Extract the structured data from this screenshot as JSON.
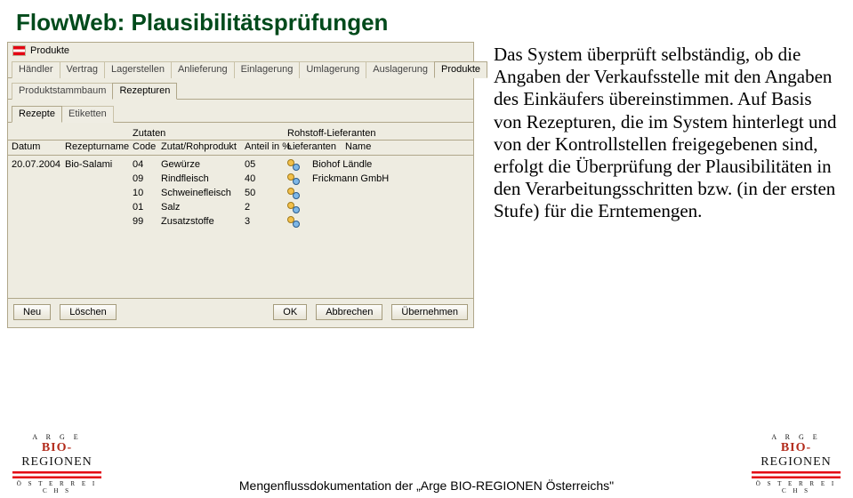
{
  "title": "FlowWeb: Plausibilitätsprüfungen",
  "description": "Das System überprüft selbständig, ob die Angaben der Verkaufsstelle mit den Angaben des Einkäufers übereinstimmen. Auf Basis von Rezepturen, die im System hinterlegt und von der Kontrollstellen freigegebenen sind, erfolgt die Überprüfung der Plausibilitäten in den Verarbeitungsschritten bzw. (in der ersten Stufe) für die Erntemengen.",
  "app": {
    "header_title": "Produkte",
    "main_tabs": [
      "Händler",
      "Vertrag",
      "Lagerstellen",
      "Anlieferung",
      "Einlagerung",
      "Umlagerung",
      "Auslagerung",
      "Produkte"
    ],
    "main_active": "Produkte",
    "sub_tabs": [
      "Produktstammbaum",
      "Rezepturen"
    ],
    "sub_active": "Rezepturen",
    "inner_tabs": [
      "Rezepte",
      "Etiketten"
    ],
    "inner_active": "Rezepte",
    "group_headers": {
      "zutaten": "Zutaten",
      "lieferanten": "Rohstoff-Lieferanten"
    },
    "col_headers": [
      "Datum",
      "Rezepturname",
      "Code",
      "Zutat/Rohprodukt",
      "Anteil in %",
      "Lieferanten",
      "Name"
    ],
    "rows": [
      {
        "date": "20.07.2004",
        "recipe": "Bio-Salami",
        "code": "04",
        "zutat": "Gewürze",
        "anteil": "05",
        "name": "Biohof Ländle"
      },
      {
        "date": "",
        "recipe": "",
        "code": "09",
        "zutat": "Rindfleisch",
        "anteil": "40",
        "name": "Frickmann GmbH"
      },
      {
        "date": "",
        "recipe": "",
        "code": "10",
        "zutat": "Schweinefleisch",
        "anteil": "50",
        "name": ""
      },
      {
        "date": "",
        "recipe": "",
        "code": "01",
        "zutat": "Salz",
        "anteil": "2",
        "name": ""
      },
      {
        "date": "",
        "recipe": "",
        "code": "99",
        "zutat": "Zusatzstoffe",
        "anteil": "3",
        "name": ""
      }
    ],
    "buttons": {
      "neu": "Neu",
      "loeschen": "Löschen",
      "ok": "OK",
      "abbrechen": "Abbrechen",
      "uebernehmen": "Übernehmen"
    }
  },
  "footer_text": "Mengenflussdokumentation der „Arge BIO-REGIONEN Österreichs\"",
  "logo": {
    "arge": "A R G E",
    "bio_b": "BIO-",
    "bio_r": "REGIONEN",
    "ost": "Ö S T E R R E I C H S"
  }
}
